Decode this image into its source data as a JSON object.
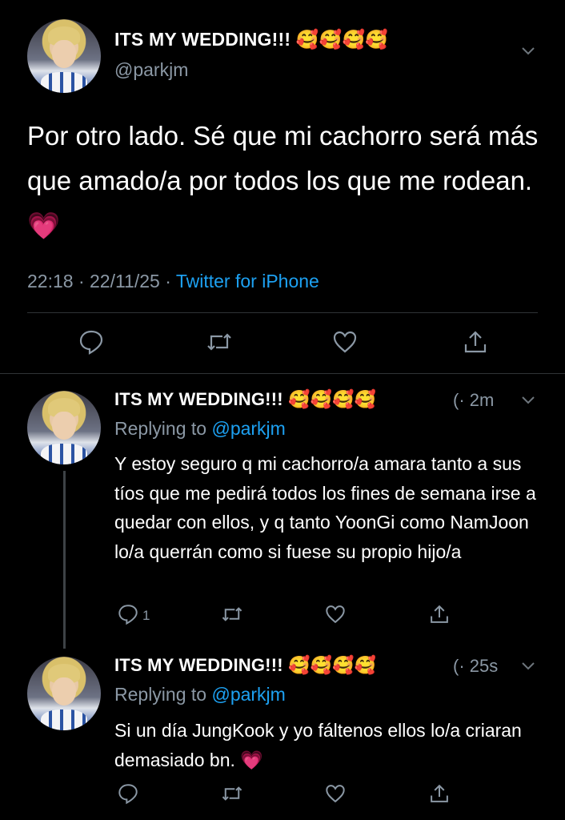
{
  "main_tweet": {
    "display_name": "ITS MY WEDDING!!!",
    "emojis": "🥰🥰🥰🥰",
    "handle": "@parkjm",
    "text": "Por otro lado. Sé que mi cachorro será más que amado/a por todos los que me rodean.",
    "text_emoji": "💗",
    "time": "22:18 · 22/11/25 ·",
    "source": "Twitter for iPhone"
  },
  "reply_1": {
    "display_name": "ITS MY WEDDING!!!",
    "emojis": "🥰🥰🥰🥰",
    "time_partial": "(· 2m",
    "replying_prefix": "Replying to",
    "replying_handle": "@parkjm",
    "text": "Y estoy seguro q mi cachorro/a amara tanto a sus tíos que me pedirá todos los fines de semana irse a quedar con ellos, y q tanto YoonGi como NamJoon lo/a querrán como si fuese su propio hijo/a",
    "reply_count": "1"
  },
  "reply_2": {
    "display_name": "ITS MY WEDDING!!!",
    "emojis": "🥰🥰🥰🥰",
    "time_partial": "(· 25s",
    "replying_prefix": "Replying to",
    "replying_handle": "@parkjm",
    "text": "Si un día JungKook y yo fáltenos ellos lo/a criaran demasiado bn.",
    "text_emoji": "💗"
  },
  "colors": {
    "background": "#000000",
    "secondary_text": "#8b98a5",
    "link": "#1da1f2",
    "divider": "#2f3336"
  },
  "icons": [
    "reply-icon",
    "retweet-icon",
    "like-icon",
    "share-icon",
    "chevron-down-icon"
  ]
}
